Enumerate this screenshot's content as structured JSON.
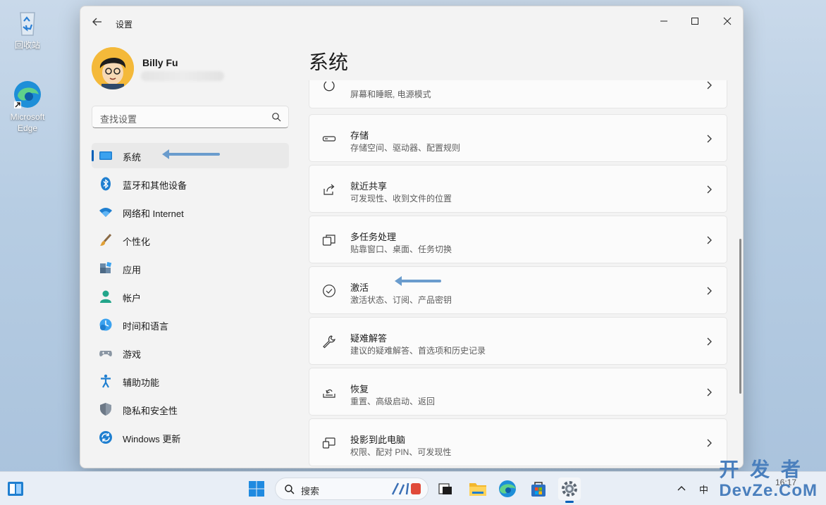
{
  "desktop": {
    "recycle_bin_label": "回收站",
    "edge_label": "Microsoft Edge"
  },
  "window": {
    "title": "设置",
    "minimize_icon": "minimize-icon",
    "maximize_icon": "maximize-icon",
    "close_icon": "close-icon"
  },
  "profile": {
    "name": "Billy Fu"
  },
  "search": {
    "placeholder": "查找设置"
  },
  "sidebar": {
    "items": [
      {
        "label": "系统",
        "icon": "system-icon",
        "active": true
      },
      {
        "label": "蓝牙和其他设备",
        "icon": "bluetooth-icon"
      },
      {
        "label": "网络和 Internet",
        "icon": "wifi-icon"
      },
      {
        "label": "个性化",
        "icon": "brush-icon"
      },
      {
        "label": "应用",
        "icon": "apps-icon"
      },
      {
        "label": "帐户",
        "icon": "account-icon"
      },
      {
        "label": "时间和语言",
        "icon": "clock-globe-icon"
      },
      {
        "label": "游戏",
        "icon": "gamepad-icon"
      },
      {
        "label": "辅助功能",
        "icon": "accessibility-icon"
      },
      {
        "label": "隐私和安全性",
        "icon": "shield-icon"
      },
      {
        "label": "Windows 更新",
        "icon": "update-icon"
      }
    ]
  },
  "main": {
    "title": "系统",
    "cards": [
      {
        "title": "",
        "subtitle": "屏幕和睡眠, 电源模式",
        "icon": "power-icon"
      },
      {
        "title": "存储",
        "subtitle": "存储空间、驱动器、配置规则",
        "icon": "storage-icon"
      },
      {
        "title": "就近共享",
        "subtitle": "可发现性、收到文件的位置",
        "icon": "share-icon"
      },
      {
        "title": "多任务处理",
        "subtitle": "贴靠窗口、桌面、任务切换",
        "icon": "multitask-icon"
      },
      {
        "title": "激活",
        "subtitle": "激活状态、订阅、产品密钥",
        "icon": "check-circle-icon"
      },
      {
        "title": "疑难解答",
        "subtitle": "建议的疑难解答、首选项和历史记录",
        "icon": "wrench-icon"
      },
      {
        "title": "恢复",
        "subtitle": "重置、高级启动、返回",
        "icon": "recovery-icon"
      },
      {
        "title": "投影到此电脑",
        "subtitle": "权限、配对 PIN、可发现性",
        "icon": "project-icon"
      }
    ]
  },
  "taskbar": {
    "search_placeholder": "搜索",
    "ime": "中",
    "clock_time": "16:17"
  },
  "watermark": {
    "line1": "开 发 者",
    "line2": "DevZe.CoM"
  },
  "colors": {
    "accent": "#005fb8",
    "annotation_arrow": "#6a9ccd"
  }
}
